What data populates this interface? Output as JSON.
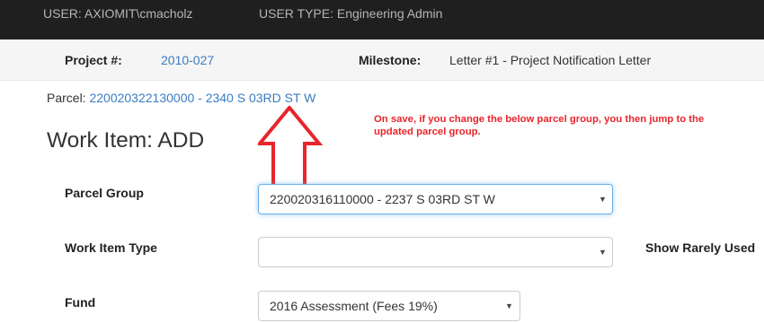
{
  "topbar": {
    "user": "USER: AXIOMIT\\cmacholz",
    "user_type": "USER TYPE: Engineering Admin"
  },
  "info": {
    "project_label": "Project #:",
    "project_value": "2010-027",
    "milestone_label": "Milestone:",
    "milestone_value": "Letter #1 - Project Notification Letter"
  },
  "parcel": {
    "label": "Parcel:",
    "value": "220020322130000 - 2340 S 03RD ST W"
  },
  "annotation": {
    "line1": "On save, if you change the below parcel group, you then jump to the",
    "line2": "updated parcel group.",
    "color": "#e8252b"
  },
  "page_title": "Work Item: ADD",
  "form": {
    "parcel_group": {
      "label": "Parcel Group",
      "value": "220020316110000 - 2237 S 03RD ST W"
    },
    "work_item_type": {
      "label": "Work Item Type",
      "value": "",
      "show_rarely_used": "Show Rarely Used"
    },
    "fund": {
      "label": "Fund",
      "value": "2016 Assessment (Fees 19%)"
    }
  },
  "colors": {
    "topbar_bg": "#1f1f1f",
    "link": "#3a7cc2",
    "focus_border": "#66afe9"
  },
  "icons": {
    "dropdown": "chevron-down-icon",
    "annotation_arrow": "up-arrow-icon"
  }
}
